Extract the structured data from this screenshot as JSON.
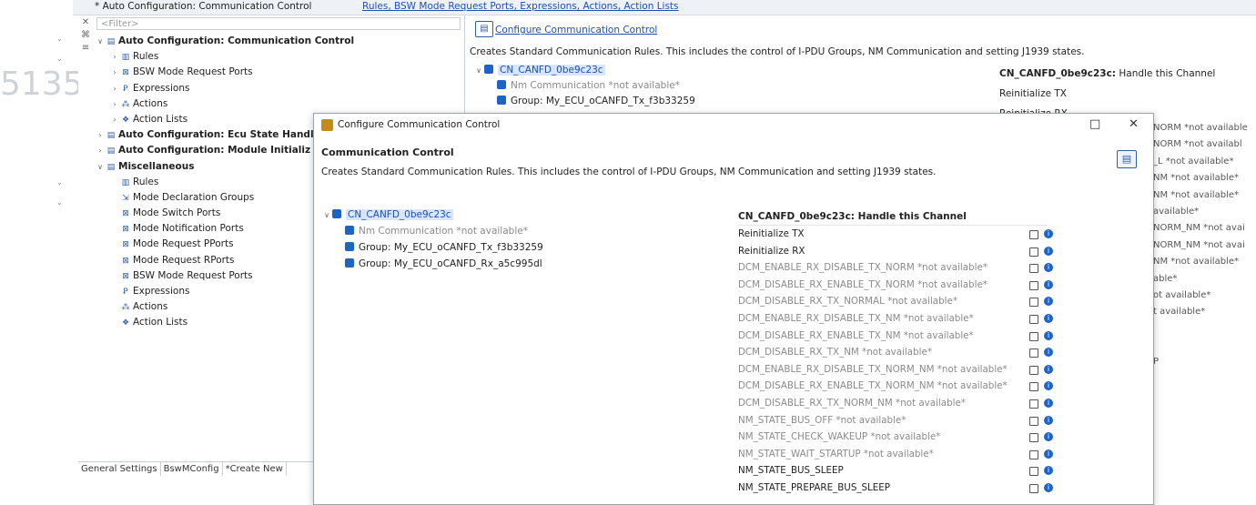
{
  "editor_tab": {
    "title": "* Auto Configuration: Communication Control",
    "links": "Rules, BSW Mode Request Ports, Expressions, Actions, Action Lists"
  },
  "background_number": "5135",
  "tree": {
    "filter_placeholder": "<Filter>",
    "items": [
      {
        "label": "Auto Configuration: Communication Control",
        "bold": true,
        "expander": "∨",
        "icon": "config-icon",
        "level": 0
      },
      {
        "label": "Rules",
        "bold": false,
        "expander": "›",
        "icon": "rules-icon",
        "level": 1
      },
      {
        "label": "BSW Mode Request Ports",
        "bold": false,
        "expander": "›",
        "icon": "port-icon",
        "level": 1
      },
      {
        "label": "Expressions",
        "bold": false,
        "expander": "›",
        "icon": "expression-icon",
        "level": 1
      },
      {
        "label": "Actions",
        "bold": false,
        "expander": "›",
        "icon": "action-icon",
        "level": 1
      },
      {
        "label": "Action Lists",
        "bold": false,
        "expander": "›",
        "icon": "action-list-icon",
        "level": 1
      },
      {
        "label": "Auto Configuration: Ecu State Handl",
        "bold": true,
        "expander": "›",
        "icon": "config-icon",
        "level": 0
      },
      {
        "label": "Auto Configuration: Module Initializ",
        "bold": true,
        "expander": "›",
        "icon": "config-icon",
        "level": 0
      },
      {
        "label": "Miscellaneous",
        "bold": true,
        "expander": "∨",
        "icon": "folder-icon",
        "level": 0
      },
      {
        "label": "Rules",
        "bold": false,
        "expander": "",
        "icon": "rules-icon",
        "level": 1
      },
      {
        "label": "Mode Declaration Groups",
        "bold": false,
        "expander": "",
        "icon": "mode-icon",
        "level": 1
      },
      {
        "label": "Mode Switch Ports",
        "bold": false,
        "expander": "",
        "icon": "port-icon",
        "level": 1
      },
      {
        "label": "Mode Notification Ports",
        "bold": false,
        "expander": "",
        "icon": "port-icon",
        "level": 1
      },
      {
        "label": "Mode Request PPorts",
        "bold": false,
        "expander": "",
        "icon": "port-icon",
        "level": 1
      },
      {
        "label": "Mode Request RPorts",
        "bold": false,
        "expander": "",
        "icon": "port-icon",
        "level": 1
      },
      {
        "label": "BSW Mode Request Ports",
        "bold": false,
        "expander": "",
        "icon": "port-icon",
        "level": 1
      },
      {
        "label": "Expressions",
        "bold": false,
        "expander": "",
        "icon": "expression-icon",
        "level": 1
      },
      {
        "label": "Actions",
        "bold": false,
        "expander": "",
        "icon": "action-icon",
        "level": 1
      },
      {
        "label": "Action Lists",
        "bold": false,
        "expander": "",
        "icon": "action-list-icon",
        "level": 1
      }
    ],
    "tabs": [
      "General Settings",
      "BswMConfig",
      "*Create New"
    ]
  },
  "editor": {
    "header_link": "Configure Communication Control",
    "description": "Creates Standard Communication Rules. This includes the control of I-PDU Groups, NM Communication and setting J1939 states.",
    "tree": [
      {
        "label": "CN_CANFD_0be9c23c",
        "checked": true,
        "selected": true,
        "grey": false
      },
      {
        "label": "Nm Communication *not available*",
        "checked": true,
        "selected": false,
        "grey": true
      },
      {
        "label": "Group: My_ECU_oCANFD_Tx_f3b33259",
        "checked": true,
        "selected": false,
        "grey": false
      }
    ],
    "right_title_bold": "CN_CANFD_0be9c23c:",
    "right_title_rest": "Handle this Channel",
    "right_items": [
      "Reinitialize TX",
      "Reinitialize RX"
    ],
    "ghost_items": [
      "NORM *not available",
      "NORM *not availabl",
      "_L *not available*",
      "NM *not available*",
      "NM *not available*",
      "available*",
      "NORM_NM *not avai",
      "NORM_NM *not avai",
      "NM *not available*",
      "able*",
      "ot available*",
      "t available*",
      "",
      "",
      "P"
    ]
  },
  "dialog": {
    "title": "Configure Communication Control",
    "heading": "Communication Control",
    "description": "Creates Standard Communication Rules. This includes the control of I-PDU Groups, NM Communication and setting J1939 states.",
    "minimize": "□",
    "close": "✕",
    "tree": [
      {
        "label": "CN_CANFD_0be9c23c",
        "checked": true,
        "selected": true,
        "grey": false,
        "expander": "∨"
      },
      {
        "label": "Nm Communication *not available*",
        "checked": true,
        "selected": false,
        "grey": true,
        "expander": ""
      },
      {
        "label": "Group: My_ECU_oCANFD_Tx_f3b33259",
        "checked": true,
        "selected": false,
        "grey": false,
        "expander": ""
      },
      {
        "label": "Group: My_ECU_oCANFD_Rx_a5c995dl",
        "checked": true,
        "selected": false,
        "grey": false,
        "expander": ""
      }
    ],
    "channel_title": "CN_CANFD_0be9c23c: Handle this Channel",
    "properties": [
      {
        "label": "Reinitialize TX",
        "grey": false
      },
      {
        "label": "Reinitialize RX",
        "grey": false
      },
      {
        "label": "DCM_ENABLE_RX_DISABLE_TX_NORM *not available*",
        "grey": true
      },
      {
        "label": "DCM_DISABLE_RX_ENABLE_TX_NORM *not available*",
        "grey": true
      },
      {
        "label": "DCM_DISABLE_RX_TX_NORMAL *not available*",
        "grey": true
      },
      {
        "label": "DCM_ENABLE_RX_DISABLE_TX_NM *not available*",
        "grey": true
      },
      {
        "label": "DCM_DISABLE_RX_ENABLE_TX_NM *not available*",
        "grey": true
      },
      {
        "label": "DCM_DISABLE_RX_TX_NM *not available*",
        "grey": true
      },
      {
        "label": "DCM_ENABLE_RX_DISABLE_TX_NORM_NM *not available*",
        "grey": true
      },
      {
        "label": "DCM_DISABLE_RX_ENABLE_TX_NORM_NM *not available*",
        "grey": true
      },
      {
        "label": "DCM_DISABLE_RX_TX_NORM_NM *not available*",
        "grey": true
      },
      {
        "label": "NM_STATE_BUS_OFF *not available*",
        "grey": true
      },
      {
        "label": "NM_STATE_CHECK_WAKEUP *not available*",
        "grey": true
      },
      {
        "label": "NM_STATE_WAIT_STARTUP *not available*",
        "grey": true
      },
      {
        "label": "NM_STATE_BUS_SLEEP",
        "grey": false
      },
      {
        "label": "NM_STATE_PREPARE_BUS_SLEEP",
        "grey": false
      }
    ]
  },
  "colors": {
    "accent": "#1e63c6",
    "link": "#1f4fb0",
    "selection": "#d7e6fb",
    "disabled_text": "#8a8a8a"
  }
}
